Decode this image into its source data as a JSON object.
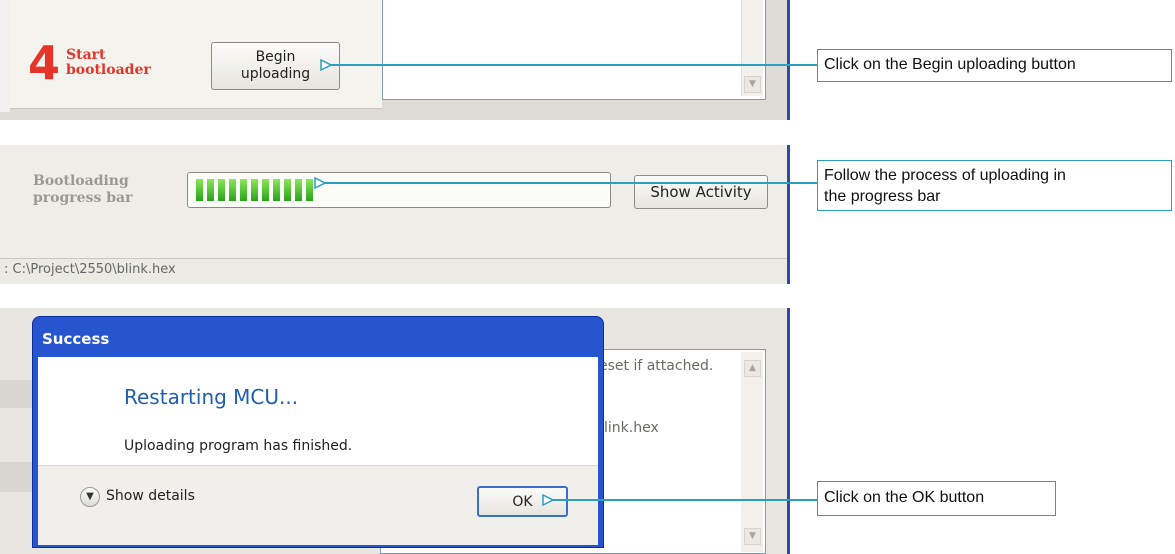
{
  "panel1": {
    "step_number": "4",
    "step_label_line1": "Start",
    "step_label_line2": "bootloader",
    "begin_button_line1": "Begin",
    "begin_button_line2": "uploading"
  },
  "panel2": {
    "label_line1": "Bootloading",
    "label_line2": "progress bar",
    "progress_segments_filled": 11,
    "show_activity_label": "Show Activity",
    "status_text": ": C:\\Project\\2550\\blink.hex"
  },
  "panel3": {
    "log_line1": "eset if attached.",
    "log_line2": "link.hex",
    "dialog": {
      "title": "Success",
      "heading": "Restarting MCU...",
      "message": "Uploading program has finished.",
      "show_details_label": "Show details",
      "ok_label": "OK"
    }
  },
  "callouts": {
    "begin": "Click on the Begin uploading button",
    "progress_line1": "Follow the process of uploading in",
    "progress_line2": "the progress bar",
    "ok": "Click on the OK button"
  },
  "colors": {
    "accent_red": "#e5342a",
    "window_border_blue": "#2f49a8",
    "callout_line": "#2a9fc0",
    "progress_green": "#2aa11b"
  }
}
